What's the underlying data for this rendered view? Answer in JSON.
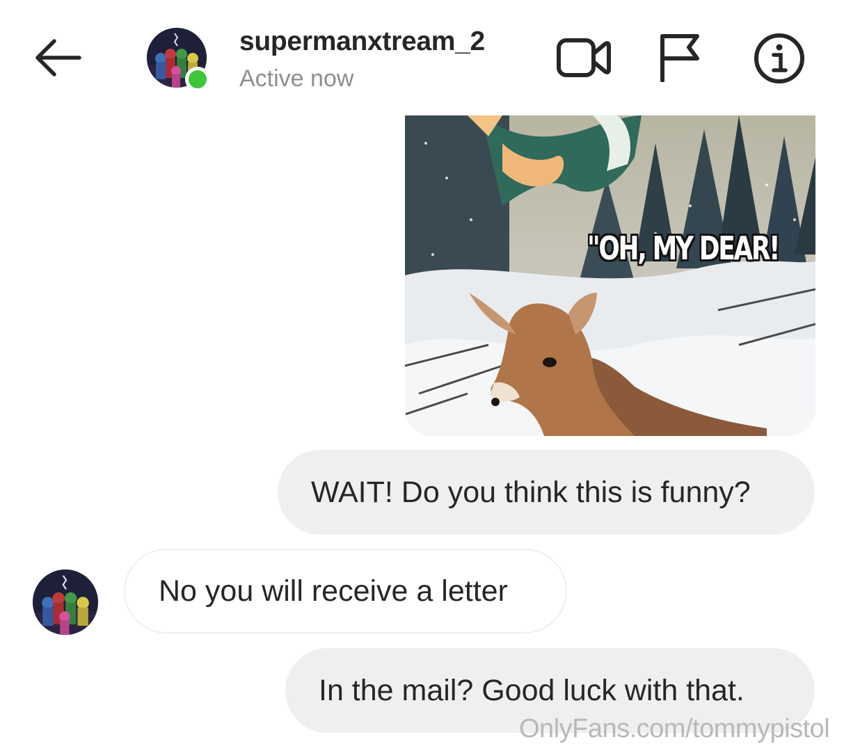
{
  "header": {
    "back_icon": "arrow-left-icon",
    "username": "supermanxtream_2",
    "status": "Active now",
    "status_color": "#3fc53a",
    "actions": [
      {
        "icon": "video-call-icon"
      },
      {
        "icon": "flag-icon"
      },
      {
        "icon": "info-icon"
      }
    ]
  },
  "thread": {
    "shared_image": {
      "caption": "\"OH, MY DEAR!"
    },
    "messages": [
      {
        "direction": "sent",
        "text": "WAIT! Do you think this is funny?"
      },
      {
        "direction": "received",
        "text": "No you will receive a letter"
      },
      {
        "direction": "sent",
        "text": "In the mail? Good luck with that."
      }
    ]
  },
  "watermark": "OnlyFans.com/tommypistol",
  "colors": {
    "sent_bubble": "#efefef",
    "text": "#262626",
    "secondary_text": "#8e8e8e"
  }
}
